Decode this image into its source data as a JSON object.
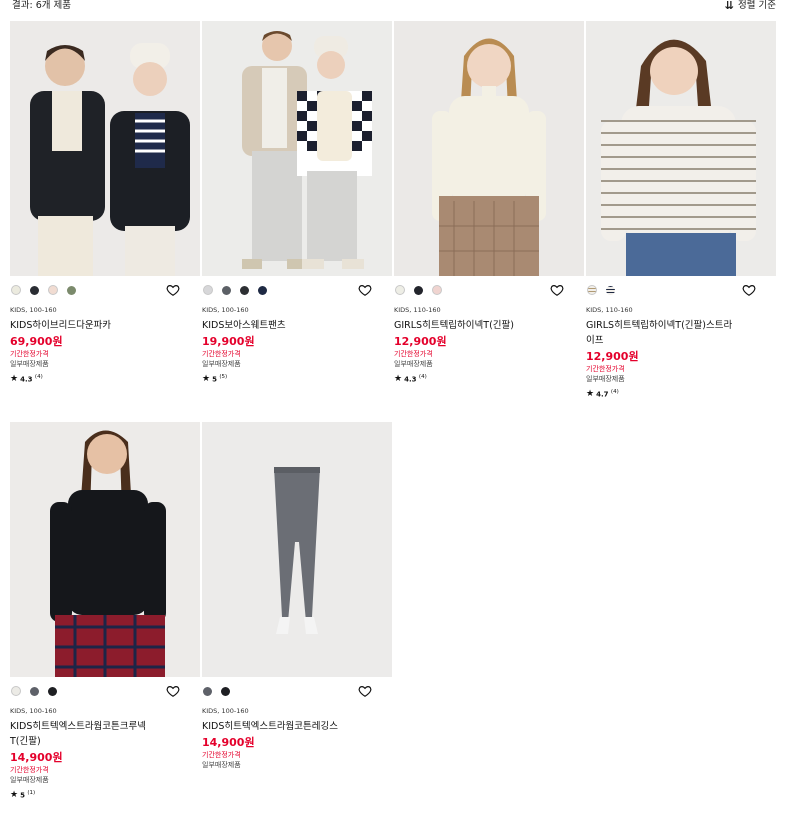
{
  "header": {
    "result_count": "결과: 6개 제품",
    "sort_icon": "sort-descending-icon",
    "sort_label": "정렬 기준"
  },
  "colors": {
    "price_red": "#e4002b"
  },
  "products": [
    {
      "size": "KIDS, 100-160",
      "name": "KIDS하이브리드다운파카",
      "price": "69,900원",
      "promo": "기간한정가격",
      "availability": "일부매장제품",
      "rating": "4.3",
      "review_count": "(4)",
      "swatches": [
        "#ecebdf",
        "#2a2d33",
        "#f1dcd2",
        "#7b8a6c"
      ]
    },
    {
      "size": "KIDS, 100-160",
      "name": "KIDS보아스웨트팬츠",
      "price": "19,900원",
      "promo": "기간한정가격",
      "availability": "일부매장제품",
      "rating": "5",
      "review_count": "(5)",
      "swatches": [
        "#d7d7d9",
        "#5c6066",
        "#2d2f33",
        "#1f2a44"
      ]
    },
    {
      "size": "KIDS, 110-160",
      "name": "GIRLS히트텍립하이넥T(긴팔)",
      "price": "12,900원",
      "promo": "기간한정가격",
      "availability": "일부매장제품",
      "rating": "4.3",
      "review_count": "(4)",
      "swatches": [
        "#eeeee6",
        "#23252c",
        "#f0d4d0"
      ]
    },
    {
      "size": "KIDS, 110-160",
      "name": "GIRLS히트텍립하이넥T(긴팔)스트라이프",
      "price": "12,900원",
      "promo": "기간한정가격",
      "availability": "일부매장제품",
      "rating": "4.7",
      "review_count": "(4)",
      "swatches": [
        "stripe-beige",
        "stripe-navy"
      ]
    },
    {
      "size": "KIDS, 100-160",
      "name": "KIDS히트텍엑스트라웜코튼크루넥T(긴팔)",
      "price": "14,900원",
      "promo": "기간한정가격",
      "availability": "일부매장제품",
      "rating": "5",
      "review_count": "(1)",
      "swatches": [
        "#ecebe6",
        "#5e6169",
        "#1e1f23"
      ]
    },
    {
      "size": "KIDS, 100-160",
      "name": "KIDS히트텍엑스트라웜코튼레깅스",
      "price": "14,900원",
      "promo": "기간한정가격",
      "availability": "일부매장제품",
      "rating": "",
      "review_count": "",
      "swatches": [
        "#5e6169",
        "#1e1f23"
      ]
    }
  ]
}
